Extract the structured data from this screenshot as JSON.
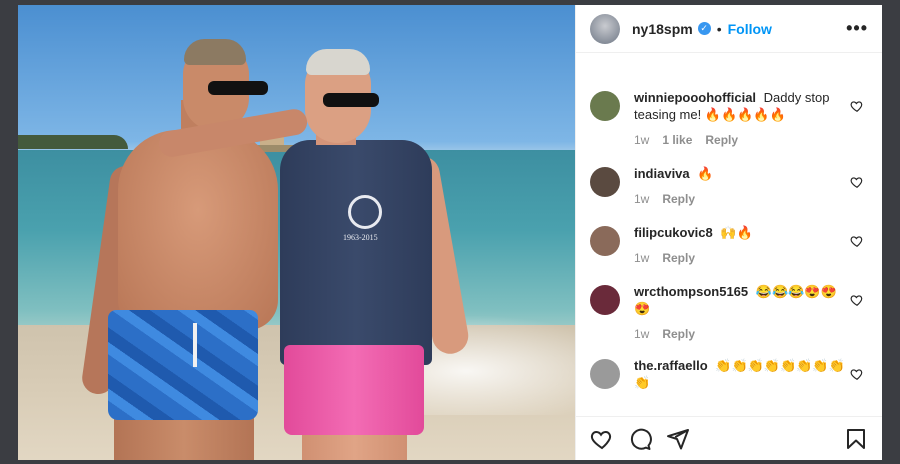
{
  "header": {
    "username": "ny18spm",
    "dot": "•",
    "follow_label": "Follow",
    "more_label": "•••"
  },
  "photo": {
    "shirt_logo_text": "1963-2015"
  },
  "comments": [
    {
      "username": "winniepooohofficial",
      "text": "Daddy stop teasing me! 🔥🔥🔥🔥🔥",
      "time": "1w",
      "likes": "1 like",
      "reply": "Reply",
      "avatar_color": "#6a7a4e"
    },
    {
      "username": "indiaviva",
      "text": "🔥",
      "time": "1w",
      "likes": "",
      "reply": "Reply",
      "avatar_color": "#5a4a40"
    },
    {
      "username": "filipcukovic8",
      "text": "🙌🔥",
      "time": "1w",
      "likes": "",
      "reply": "Reply",
      "avatar_color": "#8a6a5a"
    },
    {
      "username": "wrcthompson5165",
      "text": "😂😂😂😍😍😍",
      "time": "1w",
      "likes": "",
      "reply": "Reply",
      "avatar_color": "#6a2a3a"
    },
    {
      "username": "the.raffaello",
      "text": "👏👏👏👏👏👏👏👏👏",
      "time": "",
      "likes": "",
      "reply": "",
      "avatar_color": "#9a9a9a"
    }
  ],
  "actions": {
    "like_icon": "heart-icon",
    "comment_icon": "comment-icon",
    "share_icon": "share-icon",
    "save_icon": "bookmark-icon"
  }
}
